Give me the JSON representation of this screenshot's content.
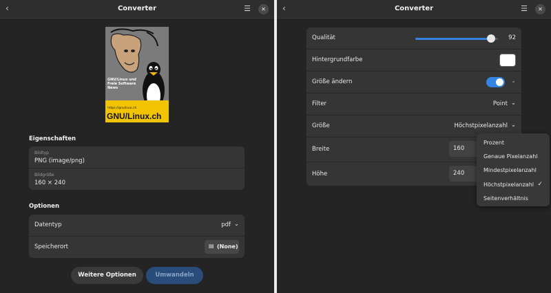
{
  "left": {
    "title": "Converter",
    "preview": {
      "line1": "GNU/Linux und",
      "line2": "Freie Software",
      "line3": "News",
      "url": "https://gnulinux.ch",
      "logo": "GNU/Linux.ch"
    },
    "properties_title": "Eigenschaften",
    "image_type_label": "Bildtyp",
    "image_type_value": "PNG (image/png)",
    "image_size_label": "Bildgröße",
    "image_size_value": "160 × 240",
    "options_title": "Optionen",
    "datatype_label": "Datentyp",
    "datatype_value": "pdf",
    "save_label": "Speicherort",
    "save_value": "(None)",
    "more_button": "Weitere Optionen",
    "convert_button": "Umwandeln"
  },
  "right": {
    "title": "Converter",
    "quality_label": "Qualität",
    "quality_value": "92",
    "quality_fraction": 0.92,
    "background_label": "Hintergrundfarbe",
    "background_color": "#ffffff",
    "resize_label": "Größe ändern",
    "resize_on": true,
    "filter_label": "Filter",
    "filter_value": "Point",
    "size_label": "Größe",
    "size_value": "Höchstpixelanzahl",
    "width_label": "Breite",
    "width_value": "160",
    "height_label": "Höhe",
    "height_value": "240",
    "size_options": [
      "Prozent",
      "Genaue Pixelanzahl",
      "Mindestpixelanzahl",
      "Höchstpixelanzahl",
      "Seitenverhältnis"
    ],
    "selected_option": "Höchstpixelanzahl"
  },
  "colors": {
    "accent": "#3584e4",
    "convert_bg": "#2a4c7a",
    "window_bg": "#242424",
    "card_bg": "#353535"
  }
}
